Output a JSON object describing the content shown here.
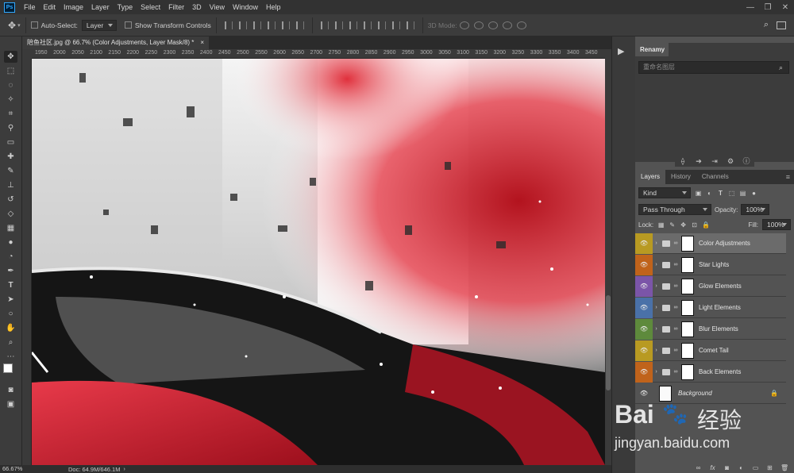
{
  "menubar": {
    "app_logo": "Ps",
    "items": [
      "File",
      "Edit",
      "Image",
      "Layer",
      "Type",
      "Select",
      "Filter",
      "3D",
      "View",
      "Window",
      "Help"
    ],
    "window_controls": [
      "—",
      "❐",
      "✕"
    ]
  },
  "options_bar": {
    "auto_select_label": "Auto-Select:",
    "auto_select_value": "Layer",
    "show_transform_label": "Show Transform Controls",
    "mode_3d_label": "3D Mode:"
  },
  "document_tab": {
    "title": "陪鱼社区.jpg @ 66.7% (Color Adjustments, Layer Mask/8) *",
    "close": "×"
  },
  "ruler": {
    "ticks": [
      "1950",
      "2000",
      "2050",
      "2100",
      "2150",
      "2200",
      "2250",
      "2300",
      "2350",
      "2400",
      "2450",
      "2500",
      "2550",
      "2600",
      "2650",
      "2700",
      "2750",
      "2800",
      "2850",
      "2900",
      "2950",
      "3000",
      "3050",
      "3100",
      "3150",
      "3200",
      "3250",
      "3300",
      "3350",
      "3400",
      "3450"
    ]
  },
  "status": {
    "zoom": "66.67%",
    "doc_info": "Doc: 64.9M/646.1M"
  },
  "renamy_panel": {
    "tab": "Renamy",
    "search_placeholder": "重命名图层"
  },
  "layers_panel": {
    "tabs": [
      "Layers",
      "History",
      "Channels"
    ],
    "filter_kind": "Kind",
    "blend_mode": "Pass Through",
    "opacity_label": "Opacity:",
    "opacity_value": "100%",
    "lock_label": "Lock:",
    "fill_label": "Fill:",
    "fill_value": "100%",
    "layers": [
      {
        "name": "Color Adjustments",
        "color": "#b89a22",
        "selected": true
      },
      {
        "name": "Star Lights",
        "color": "#c0631b",
        "selected": false
      },
      {
        "name": "Glow Elements",
        "color": "#7b55a8",
        "selected": false
      },
      {
        "name": "Light Elements",
        "color": "#4a71a8",
        "selected": false
      },
      {
        "name": "Blur Elements",
        "color": "#5e8a3c",
        "selected": false
      },
      {
        "name": "Comet Tail",
        "color": "#b89a22",
        "selected": false
      },
      {
        "name": "Back Elements",
        "color": "#c0631b",
        "selected": false
      }
    ],
    "background_layer": "Background"
  },
  "watermark": {
    "brand": "Bai",
    "brand2": "经验",
    "url": "jingyan.baidu.com"
  }
}
